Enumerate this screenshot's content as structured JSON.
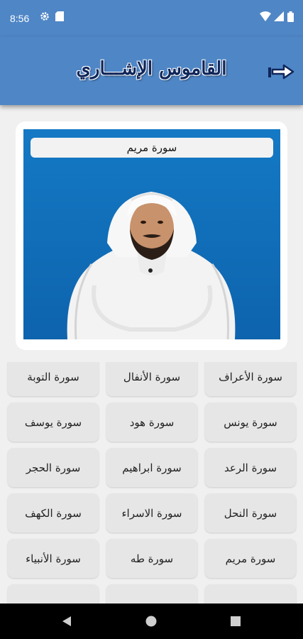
{
  "status": {
    "time": "8:56",
    "icons": [
      "gear-icon",
      "sd-card-icon",
      "wifi-icon",
      "signal-icon",
      "battery-icon"
    ]
  },
  "header": {
    "title": "القاموس الإشـــاري",
    "exit_icon": "exit-arrow-icon"
  },
  "video": {
    "title": "سورة مريم"
  },
  "grid": {
    "rows": [
      [
        "سورة الأعراف",
        "سورة الأنفال",
        "سورة التوبة"
      ],
      [
        "سورة يونس",
        "سورة هود",
        "سورة يوسف"
      ],
      [
        "سورة الرعد",
        "سورة ابراهيم",
        "سورة الحجر"
      ],
      [
        "سورة النحل",
        "سورة الاسراء",
        "سورة الكهف"
      ],
      [
        "سورة مريم",
        "سورة طه",
        "سورة الأنبياء"
      ]
    ]
  },
  "colors": {
    "header": "#4f86c6",
    "title": "#10265a",
    "video_bg": "#1479c4",
    "tile": "#e6e6e6"
  },
  "navbar": {
    "icons": [
      "back-icon",
      "home-icon",
      "recents-icon"
    ]
  }
}
